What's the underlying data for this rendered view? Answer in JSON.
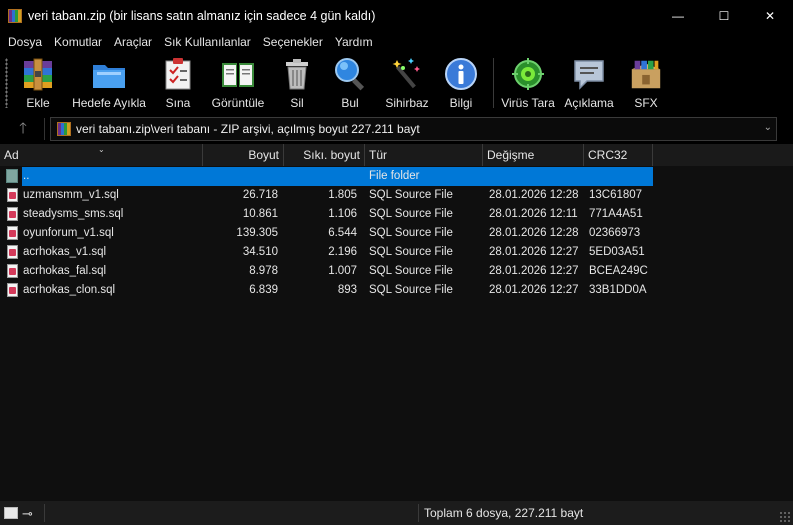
{
  "window": {
    "title": "veri tabanı.zip (bir lisans satın almanız için sadece 4 gün kaldı)",
    "minimize": "—",
    "maximize": "☐",
    "close": "✕"
  },
  "menu": [
    "Dosya",
    "Komutlar",
    "Araçlar",
    "Sık Kullanılanlar",
    "Seçenekler",
    "Yardım"
  ],
  "toolbar": {
    "ekle": "Ekle",
    "hedefe_ayikla": "Hedefe Ayıkla",
    "sina": "Sına",
    "goruntule": "Görüntüle",
    "sil": "Sil",
    "bul": "Bul",
    "sihirbaz": "Sihirbaz",
    "bilgi": "Bilgi",
    "virus_tara": "Virüs Tara",
    "aciklama": "Açıklama",
    "sfx": "SFX"
  },
  "address": {
    "up": "🡑",
    "path": "veri tabanı.zip\\veri tabanı - ZIP arşivi, açılmış boyut 227.211 bayt",
    "dropdown": "⌄"
  },
  "columns": {
    "ad": "Ad",
    "boyut": "Boyut",
    "siki_boyut": "Sıkı. boyut",
    "tur": "Tür",
    "degisme": "Değişme",
    "crc32": "CRC32",
    "sort_indicator": "⌄"
  },
  "rows": [
    {
      "name": "..",
      "size": "",
      "packed": "",
      "type": "File folder",
      "modified": "",
      "crc": "",
      "is_folder": true
    },
    {
      "name": "uzmansmm_v1.sql",
      "size": "26.718",
      "packed": "1.805",
      "type": "SQL Source File",
      "modified": "28.01.2026 12:28",
      "crc": "13C61807"
    },
    {
      "name": "steadysms_sms.sql",
      "size": "10.861",
      "packed": "1.106",
      "type": "SQL Source File",
      "modified": "28.01.2026 12:11",
      "crc": "771A4A51"
    },
    {
      "name": "oyunforum_v1.sql",
      "size": "139.305",
      "packed": "6.544",
      "type": "SQL Source File",
      "modified": "28.01.2026 12:28",
      "crc": "02366973"
    },
    {
      "name": "acrhokas_v1.sql",
      "size": "34.510",
      "packed": "2.196",
      "type": "SQL Source File",
      "modified": "28.01.2026 12:27",
      "crc": "5ED03A51"
    },
    {
      "name": "acrhokas_fal.sql",
      "size": "8.978",
      "packed": "1.007",
      "type": "SQL Source File",
      "modified": "28.01.2026 12:27",
      "crc": "BCEA249C"
    },
    {
      "name": "acrhokas_clon.sql",
      "size": "6.839",
      "packed": "893",
      "type": "SQL Source File",
      "modified": "28.01.2026 12:27",
      "crc": "33B1DD0A"
    }
  ],
  "status": {
    "key_icon": "⊸",
    "summary": "Toplam 6 dosya, 227.211 bayt"
  }
}
